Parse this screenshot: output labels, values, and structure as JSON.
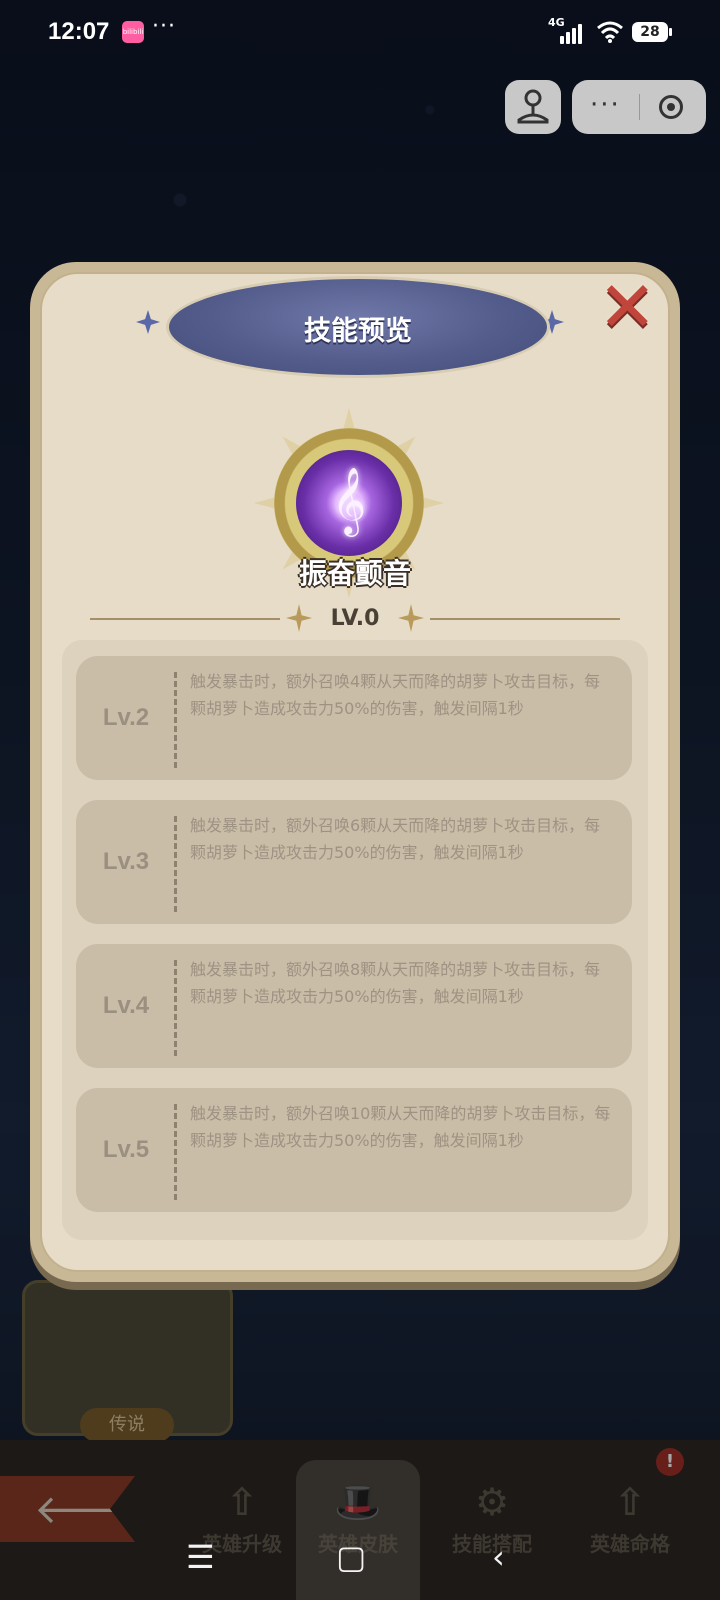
{
  "status_bar": {
    "time": "12:07",
    "app_badge": "bilibili",
    "more": "···",
    "network": "4G",
    "battery": "28"
  },
  "capsule": {
    "more": "···"
  },
  "dialog": {
    "title": "技能预览",
    "close_glyph": "✕",
    "skill": {
      "icon": "treble-clef-icon",
      "note_glyph": "𝄞",
      "name": "振奋颤音",
      "current_level": "LV.0"
    },
    "levels": [
      {
        "label": "Lv.2",
        "description": "触发暴击时，额外召唤4颗从天而降的胡萝卜攻击目标，每颗胡萝卜造成攻击力50%的伤害，触发间隔1秒"
      },
      {
        "label": "Lv.3",
        "description": "触发暴击时，额外召唤6颗从天而降的胡萝卜攻击目标，每颗胡萝卜造成攻击力50%的伤害，触发间隔1秒"
      },
      {
        "label": "Lv.4",
        "description": "触发暴击时，额外召唤8颗从天而降的胡萝卜攻击目标，每颗胡萝卜造成攻击力50%的伤害，触发间隔1秒"
      },
      {
        "label": "Lv.5",
        "description": "触发暴击时，额外召唤10颗从天而降的胡萝卜攻击目标，每颗胡萝卜造成攻击力50%的伤害，触发间隔1秒"
      }
    ]
  },
  "background": {
    "card_tag": "传说",
    "back_arrow": "🡐",
    "tabs": [
      {
        "label": "英雄升级",
        "icon": "⇧"
      },
      {
        "label": "英雄皮肤",
        "icon": "🎩"
      },
      {
        "label": "技能搭配",
        "icon": "⚙"
      },
      {
        "label": "英雄命格",
        "icon": "⇧"
      }
    ],
    "notice": "!"
  },
  "nav_bar": {
    "menu": "☰",
    "home": "▢",
    "back": "‹"
  }
}
